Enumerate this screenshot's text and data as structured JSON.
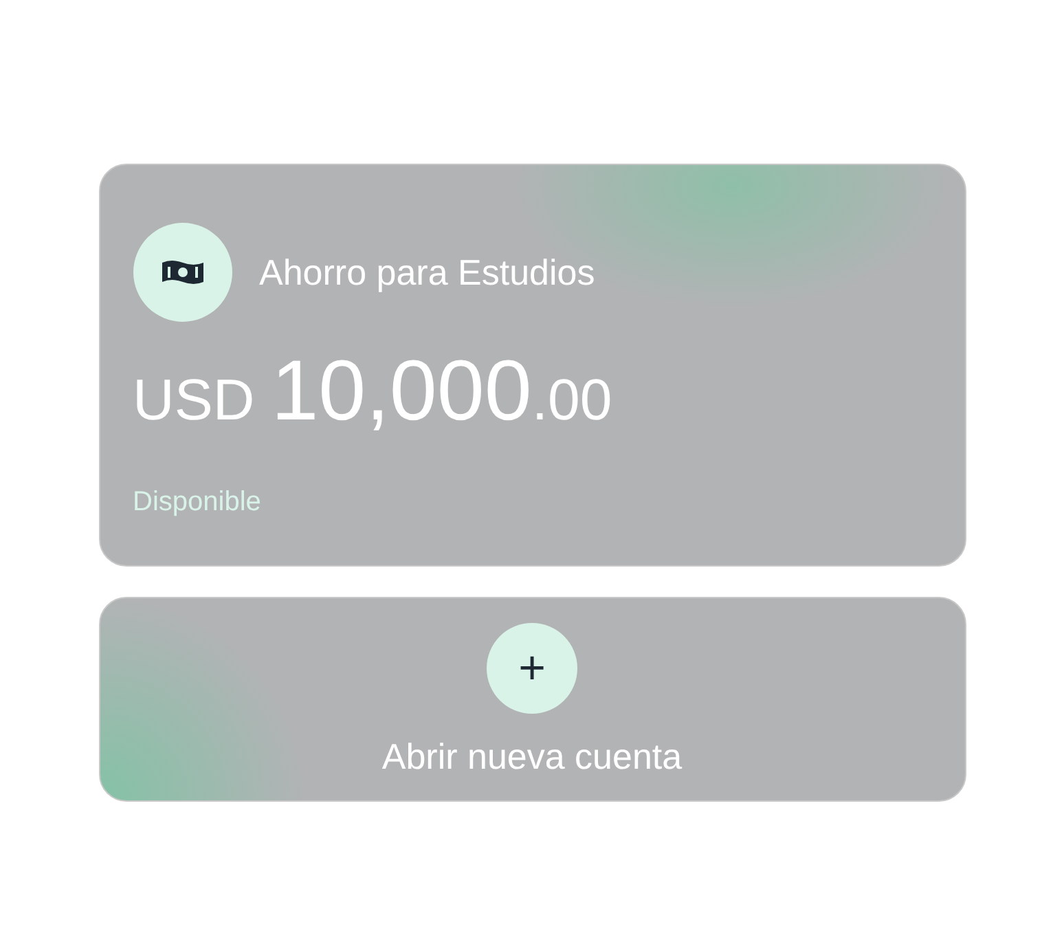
{
  "account_card": {
    "name": "Ahorro para Estudios",
    "currency": "USD",
    "amount_whole": "10,000",
    "amount_cents": ".00",
    "status": "Disponible"
  },
  "new_account_button": {
    "label": "Abrir nueva cuenta",
    "icon": "+"
  }
}
